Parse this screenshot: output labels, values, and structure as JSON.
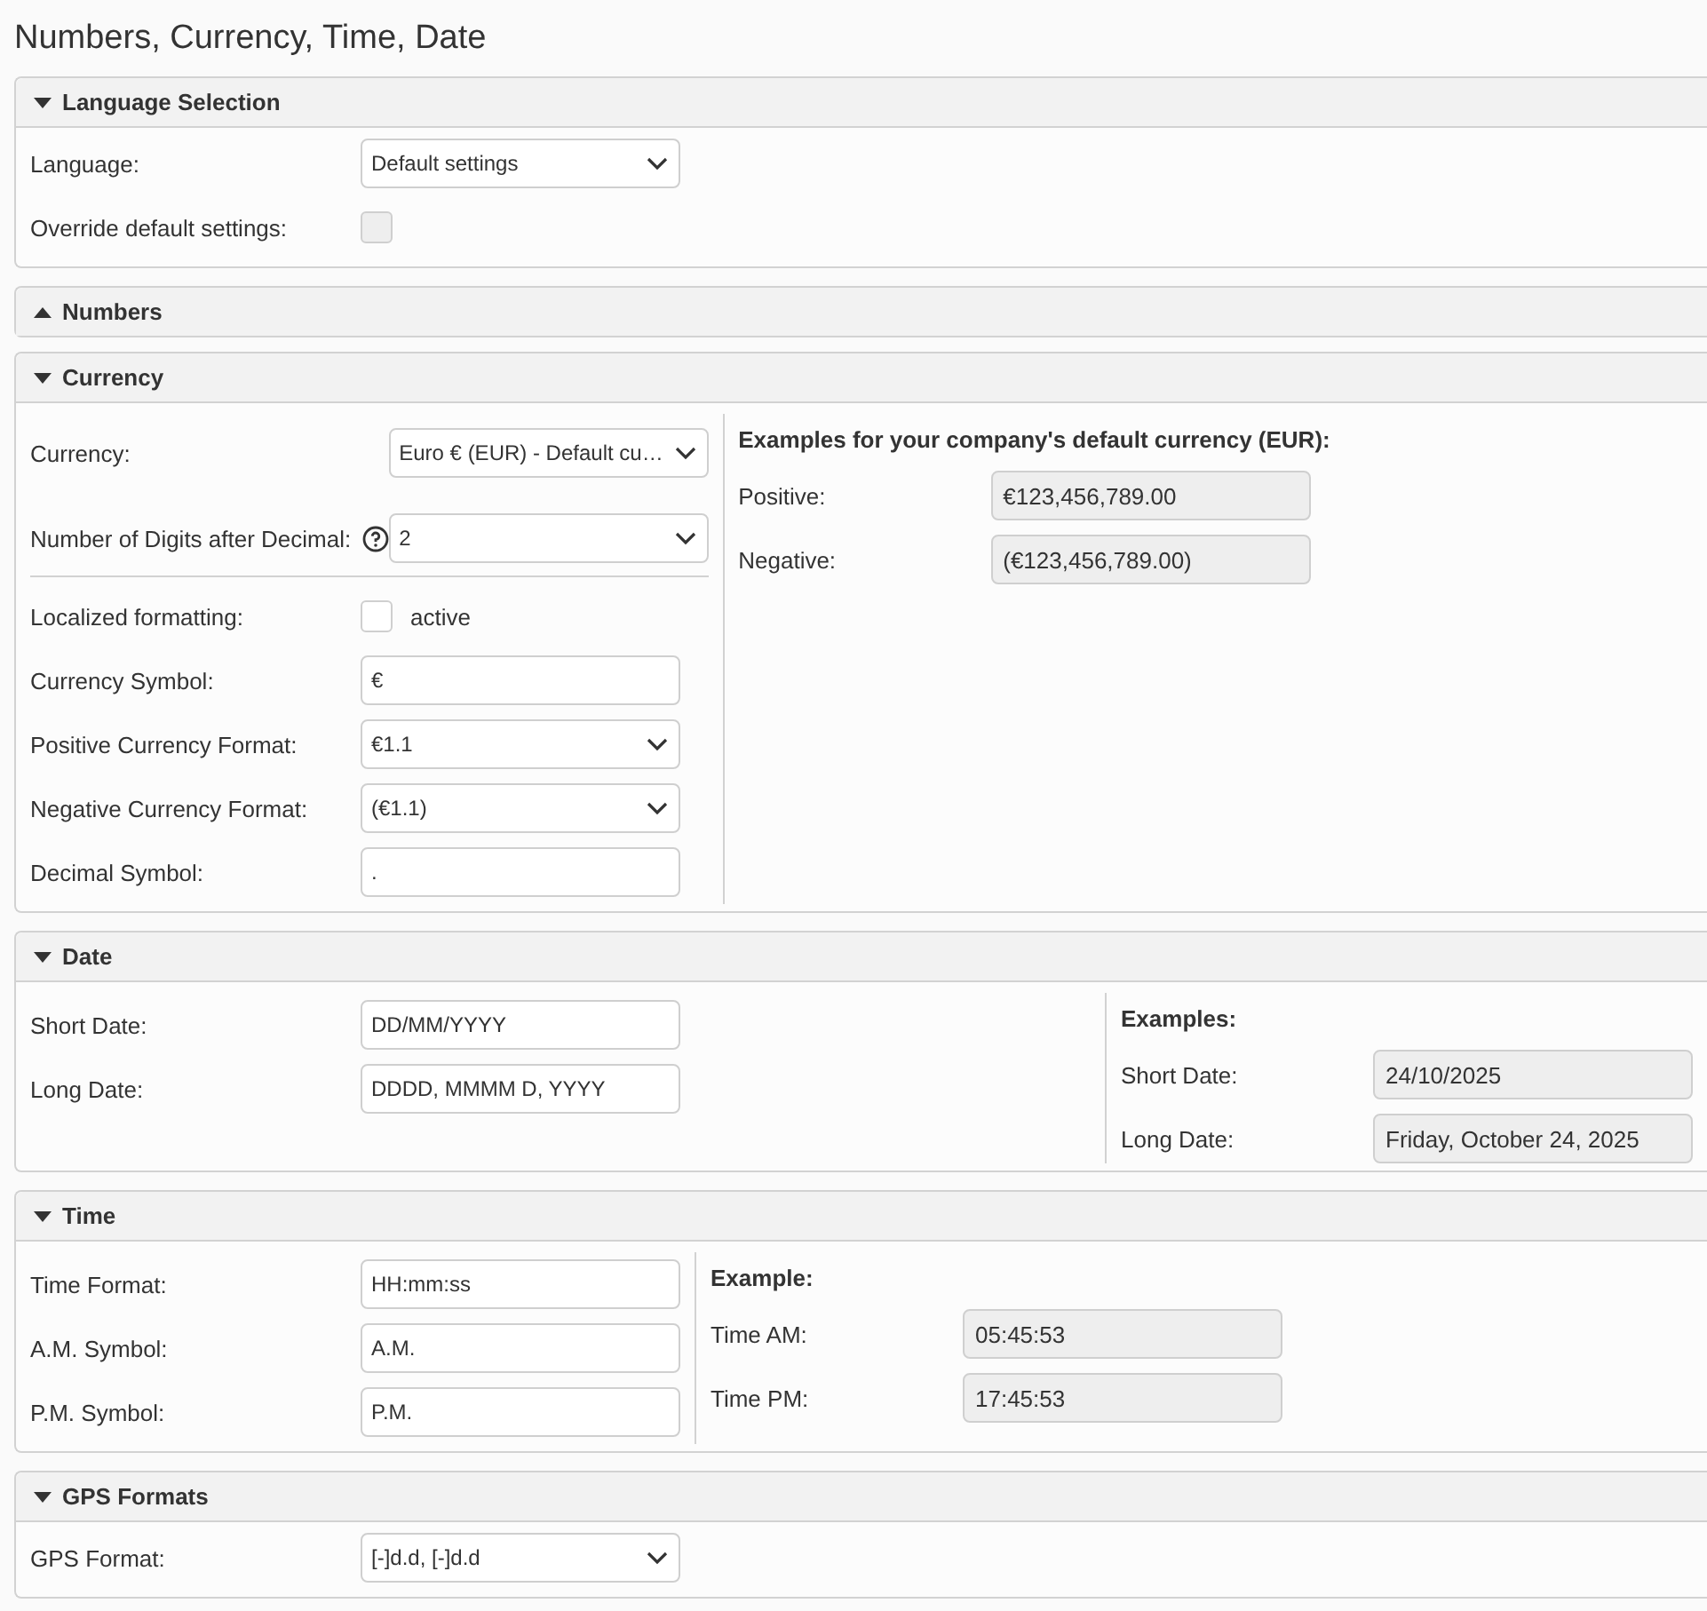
{
  "page_title": "Numbers, Currency, Time, Date",
  "sections": [
    {
      "title": "Language Selection",
      "expanded": true,
      "groups": [
        [
          {
            "kind": "select",
            "label": "Language:",
            "value": "Default settings"
          },
          {
            "kind": "checkbox",
            "label": "Override default settings:",
            "checked": false,
            "disabled": true
          }
        ]
      ]
    },
    {
      "title": "Numbers",
      "expanded": false
    },
    {
      "title": "Currency",
      "expanded": true,
      "groups": [
        [
          {
            "kind": "select",
            "label": "Currency:",
            "value": "Euro € (EUR) - Default cu…"
          },
          {
            "kind": "select",
            "label": "Number of Digits after Decimal:",
            "help": true,
            "value": "2"
          }
        ],
        [
          {
            "kind": "checkbox",
            "label": "Localized formatting:",
            "checked": false,
            "disabled": false,
            "caption": "active"
          },
          {
            "kind": "text",
            "label": "Currency Symbol:",
            "value": "€"
          },
          {
            "kind": "select",
            "label": "Positive Currency Format:",
            "value": "€1.1"
          },
          {
            "kind": "select",
            "label": "Negative Currency Format:",
            "value": "(€1.1)"
          },
          {
            "kind": "text",
            "label": "Decimal Symbol:",
            "value": "."
          }
        ]
      ],
      "examples": {
        "heading": "Examples for your company's default currency (EUR):",
        "rows": [
          {
            "label": "Positive:",
            "value": "€123,456,789.00"
          },
          {
            "label": "Negative:",
            "value": "(€123,456,789.00)"
          }
        ]
      }
    },
    {
      "title": "Date",
      "expanded": true,
      "groups": [
        [
          {
            "kind": "text",
            "label": "Short Date:",
            "value": "DD/MM/YYYY"
          },
          {
            "kind": "text",
            "label": "Long Date:",
            "value": "DDDD, MMMM D, YYYY"
          }
        ]
      ],
      "examples": {
        "heading": "Examples:",
        "rows": [
          {
            "label": "Short Date:",
            "value": "24/10/2025"
          },
          {
            "label": "Long Date:",
            "value": "Friday, October 24, 2025"
          }
        ]
      }
    },
    {
      "title": "Time",
      "expanded": true,
      "groups": [
        [
          {
            "kind": "text",
            "label": "Time Format:",
            "value": "HH:mm:ss"
          },
          {
            "kind": "text",
            "label": "A.M. Symbol:",
            "value": "A.M."
          },
          {
            "kind": "text",
            "label": "P.M. Symbol:",
            "value": "P.M."
          }
        ]
      ],
      "examples": {
        "heading": "Example:",
        "rows": [
          {
            "label": "Time AM:",
            "value": "05:45:53"
          },
          {
            "label": "Time PM:",
            "value": "17:45:53"
          }
        ]
      }
    },
    {
      "title": "GPS Formats",
      "expanded": true,
      "groups": [
        [
          {
            "kind": "select",
            "label": "GPS Format:",
            "value": "[-]d.d, [-]d.d"
          }
        ]
      ]
    }
  ]
}
